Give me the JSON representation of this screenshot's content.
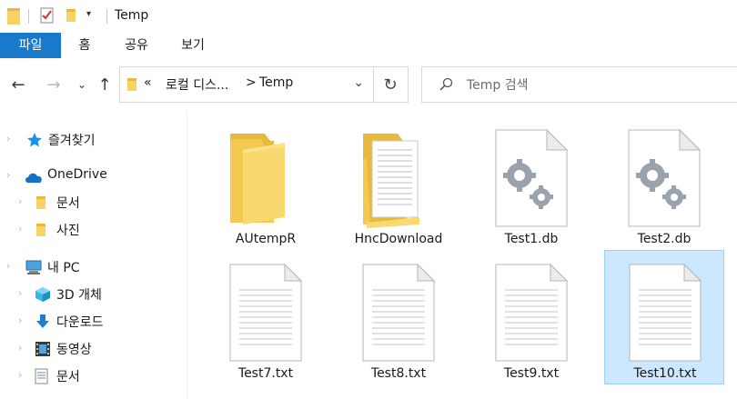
{
  "window": {
    "title": "Temp"
  },
  "ribbon": {
    "tabs": [
      "파일",
      "홈",
      "공유",
      "보기"
    ]
  },
  "address": {
    "overflow": "«",
    "crumbs": [
      "로컬 디스...",
      "Temp"
    ],
    "separator": ">"
  },
  "search": {
    "placeholder": "Temp 검색"
  },
  "sidebar": {
    "items": [
      {
        "label": "즐겨찾기",
        "icon": "star-icon"
      },
      {
        "label": "OneDrive",
        "icon": "cloud-icon"
      },
      {
        "label": "문서",
        "icon": "folder-icon"
      },
      {
        "label": "사진",
        "icon": "folder-icon"
      },
      {
        "label": "내 PC",
        "icon": "computer-icon"
      },
      {
        "label": "3D 개체",
        "icon": "cube-icon"
      },
      {
        "label": "다운로드",
        "icon": "download-arrow-icon"
      },
      {
        "label": "동영상",
        "icon": "film-icon"
      },
      {
        "label": "문서",
        "icon": "document-icon"
      }
    ]
  },
  "files": [
    {
      "name": "AUtempR",
      "type": "folder"
    },
    {
      "name": "HncDownload",
      "type": "folder-with-pages"
    },
    {
      "name": "Test1.db",
      "type": "db"
    },
    {
      "name": "Test2.db",
      "type": "db"
    },
    {
      "name": "Test7.txt",
      "type": "txt"
    },
    {
      "name": "Test8.txt",
      "type": "txt"
    },
    {
      "name": "Test9.txt",
      "type": "txt"
    },
    {
      "name": "Test10.txt",
      "type": "txt",
      "selected": true
    }
  ],
  "colors": {
    "accent": "#1979ca",
    "selection": "#cce8ff",
    "selection_border": "#99d1ff",
    "folder": "#f7d367"
  }
}
